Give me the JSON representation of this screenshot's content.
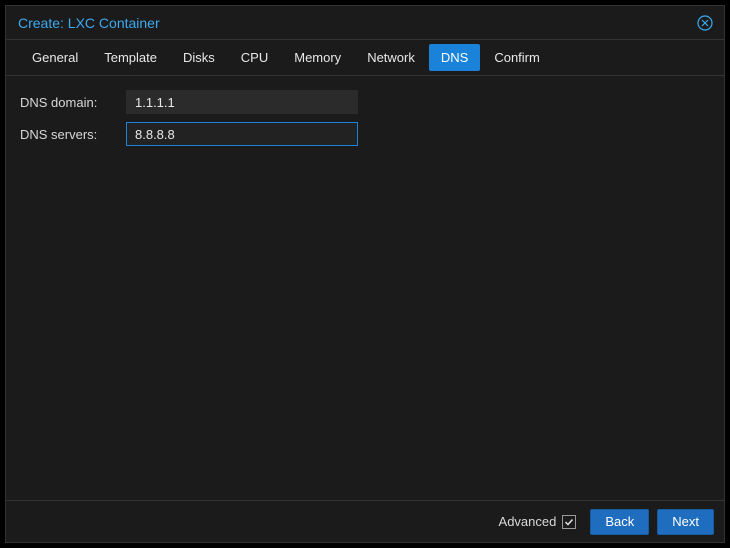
{
  "window": {
    "title": "Create: LXC Container"
  },
  "tabs": [
    {
      "label": "General",
      "active": false
    },
    {
      "label": "Template",
      "active": false
    },
    {
      "label": "Disks",
      "active": false
    },
    {
      "label": "CPU",
      "active": false
    },
    {
      "label": "Memory",
      "active": false
    },
    {
      "label": "Network",
      "active": false
    },
    {
      "label": "DNS",
      "active": true
    },
    {
      "label": "Confirm",
      "active": false
    }
  ],
  "form": {
    "dns_domain": {
      "label": "DNS domain:",
      "value": "1.1.1.1"
    },
    "dns_servers": {
      "label": "DNS servers:",
      "value": "8.8.8.8",
      "focused": true
    }
  },
  "footer": {
    "advanced_label": "Advanced",
    "advanced_checked": true,
    "back_label": "Back",
    "next_label": "Next"
  }
}
